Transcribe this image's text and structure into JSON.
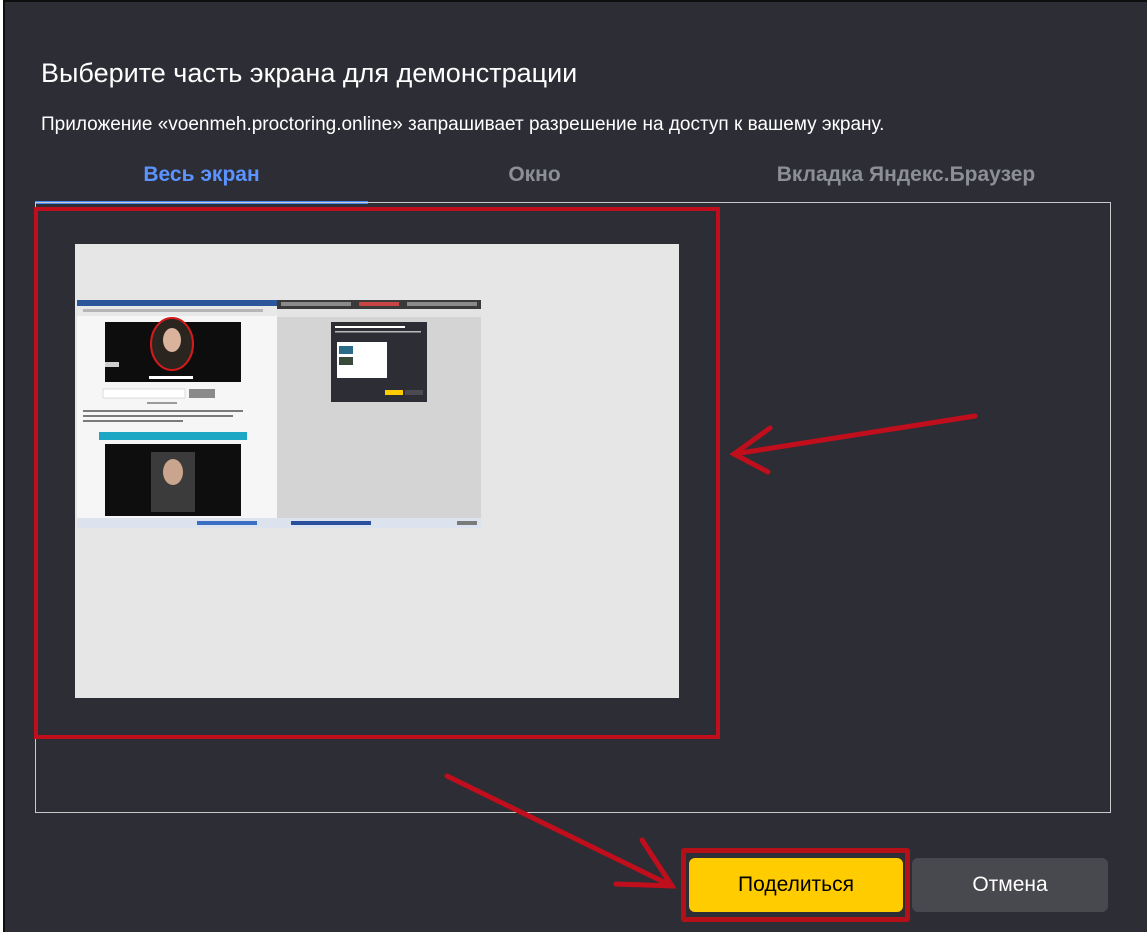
{
  "dialog": {
    "title": "Выберите часть экрана для демонстрации",
    "subtitle": "Приложение «voenmeh.proctoring.online» запрашивает разрешение на доступ к вашему экрану."
  },
  "tabs": [
    {
      "label": "Весь экран",
      "active": true
    },
    {
      "label": "Окно",
      "active": false
    },
    {
      "label": "Вкладка Яндекс.Браузер",
      "active": false
    }
  ],
  "actions": {
    "share_label": "Поделиться",
    "cancel_label": "Отмена"
  },
  "colors": {
    "dialog_bg": "#2d2d35",
    "active_tab": "#5b93ff",
    "share_button": "#ffcc00",
    "cancel_button": "#48484f",
    "annotation_red": "#c00e1c"
  },
  "icons": {
    "annotation_arrows": "red-arrow-icon"
  }
}
